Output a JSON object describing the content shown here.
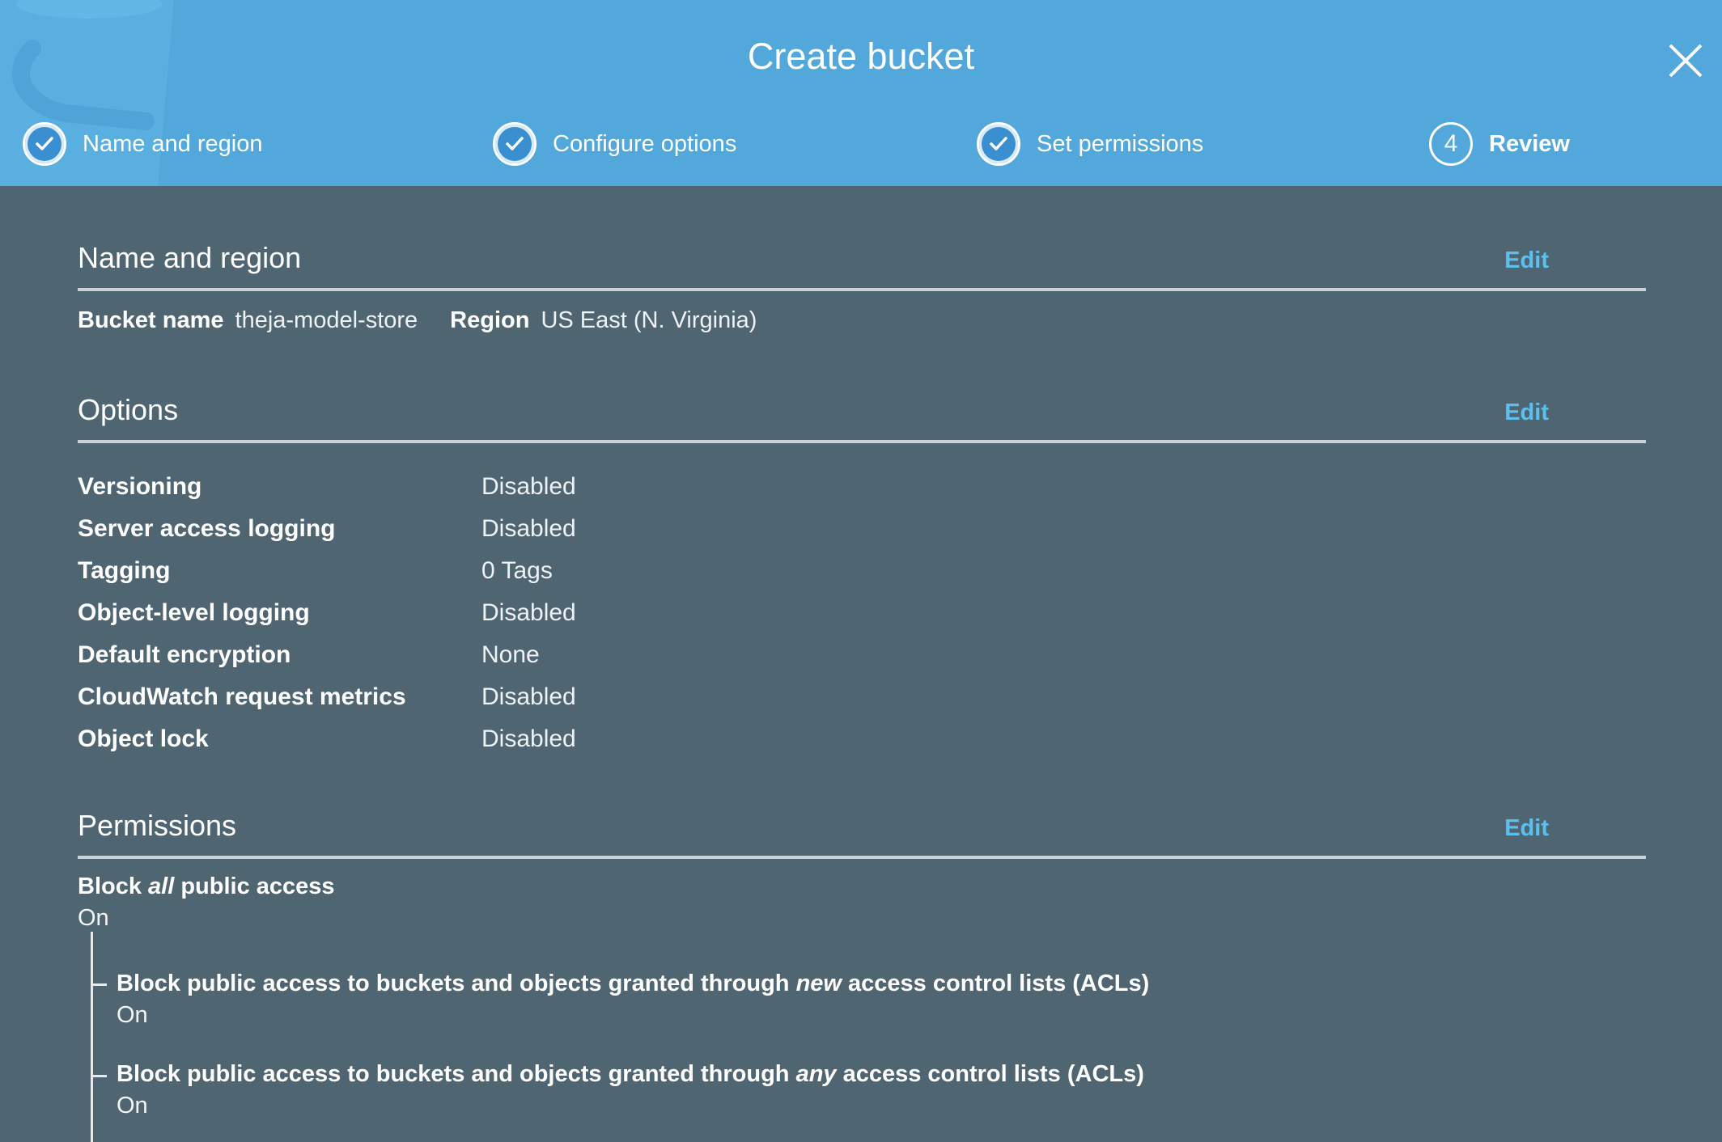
{
  "dialog": {
    "title": "Create bucket"
  },
  "steps": [
    {
      "label": "Name and region",
      "status": "complete",
      "icon": "check-circle-icon"
    },
    {
      "label": "Configure options",
      "status": "complete",
      "icon": "check-circle-icon"
    },
    {
      "label": "Set permissions",
      "status": "complete",
      "icon": "check-circle-icon"
    },
    {
      "label": "Review",
      "status": "current",
      "number": "4"
    }
  ],
  "name_region": {
    "title": "Name and region",
    "edit_label": "Edit",
    "bucket_name_label": "Bucket name",
    "bucket_name_value": "theja-model-store",
    "region_label": "Region",
    "region_value": "US East (N. Virginia)"
  },
  "options": {
    "title": "Options",
    "edit_label": "Edit",
    "rows": [
      {
        "label": "Versioning",
        "value": "Disabled"
      },
      {
        "label": "Server access logging",
        "value": "Disabled"
      },
      {
        "label": "Tagging",
        "value": "0 Tags"
      },
      {
        "label": "Object-level logging",
        "value": "Disabled"
      },
      {
        "label": "Default encryption",
        "value": "None"
      },
      {
        "label": "CloudWatch request metrics",
        "value": "Disabled"
      },
      {
        "label": "Object lock",
        "value": "Disabled"
      }
    ]
  },
  "permissions": {
    "title": "Permissions",
    "edit_label": "Edit",
    "block_all": {
      "label_pre": "Block ",
      "label_em": "all",
      "label_post": " public access",
      "value": "On"
    },
    "sub_items": [
      {
        "label_pre": "Block public access to buckets and objects granted through ",
        "label_em": "new",
        "label_post": " access control lists (ACLs)",
        "value": "On"
      },
      {
        "label_pre": "Block public access to buckets and objects granted through ",
        "label_em": "any",
        "label_post": " access control lists (ACLs)",
        "value": "On"
      }
    ]
  },
  "colors": {
    "header_bg": "#52a8db",
    "body_bg": "#4f6672",
    "link": "#5cc0ee"
  }
}
